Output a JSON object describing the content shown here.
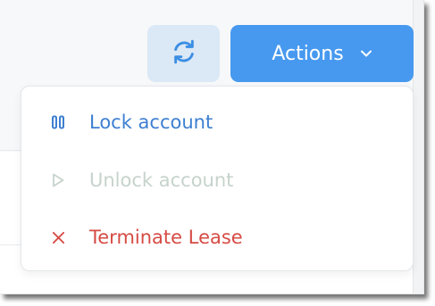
{
  "toolbar": {
    "refresh_icon": "refresh-icon",
    "actions_label": "Actions",
    "actions_icon": "chevron-down-icon"
  },
  "dropdown": {
    "items": [
      {
        "label": "Lock account",
        "icon": "pause-icon",
        "enabled": true,
        "color": "#3d7fd1"
      },
      {
        "label": "Unlock account",
        "icon": "play-icon",
        "enabled": false,
        "color": "#c6d3cc"
      },
      {
        "label": "Terminate Lease",
        "icon": "close-icon",
        "enabled": true,
        "color": "#d64b44"
      }
    ]
  },
  "colors": {
    "primary": "#4799ef",
    "refresh_bg": "#dbe8f6",
    "refresh_icon": "#3b8ee3"
  }
}
